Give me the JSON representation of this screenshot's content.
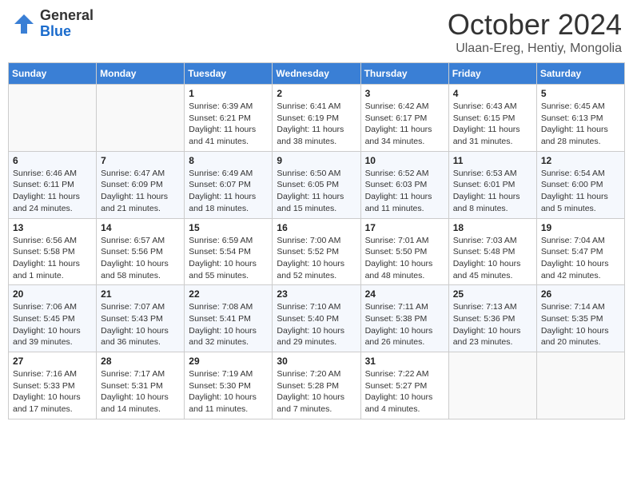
{
  "logo": {
    "general": "General",
    "blue": "Blue"
  },
  "title": {
    "month": "October 2024",
    "location": "Ulaan-Ereg, Hentiy, Mongolia"
  },
  "headers": [
    "Sunday",
    "Monday",
    "Tuesday",
    "Wednesday",
    "Thursday",
    "Friday",
    "Saturday"
  ],
  "weeks": [
    [
      {
        "day": "",
        "sunrise": "",
        "sunset": "",
        "daylight": ""
      },
      {
        "day": "",
        "sunrise": "",
        "sunset": "",
        "daylight": ""
      },
      {
        "day": "1",
        "sunrise": "Sunrise: 6:39 AM",
        "sunset": "Sunset: 6:21 PM",
        "daylight": "Daylight: 11 hours and 41 minutes."
      },
      {
        "day": "2",
        "sunrise": "Sunrise: 6:41 AM",
        "sunset": "Sunset: 6:19 PM",
        "daylight": "Daylight: 11 hours and 38 minutes."
      },
      {
        "day": "3",
        "sunrise": "Sunrise: 6:42 AM",
        "sunset": "Sunset: 6:17 PM",
        "daylight": "Daylight: 11 hours and 34 minutes."
      },
      {
        "day": "4",
        "sunrise": "Sunrise: 6:43 AM",
        "sunset": "Sunset: 6:15 PM",
        "daylight": "Daylight: 11 hours and 31 minutes."
      },
      {
        "day": "5",
        "sunrise": "Sunrise: 6:45 AM",
        "sunset": "Sunset: 6:13 PM",
        "daylight": "Daylight: 11 hours and 28 minutes."
      }
    ],
    [
      {
        "day": "6",
        "sunrise": "Sunrise: 6:46 AM",
        "sunset": "Sunset: 6:11 PM",
        "daylight": "Daylight: 11 hours and 24 minutes."
      },
      {
        "day": "7",
        "sunrise": "Sunrise: 6:47 AM",
        "sunset": "Sunset: 6:09 PM",
        "daylight": "Daylight: 11 hours and 21 minutes."
      },
      {
        "day": "8",
        "sunrise": "Sunrise: 6:49 AM",
        "sunset": "Sunset: 6:07 PM",
        "daylight": "Daylight: 11 hours and 18 minutes."
      },
      {
        "day": "9",
        "sunrise": "Sunrise: 6:50 AM",
        "sunset": "Sunset: 6:05 PM",
        "daylight": "Daylight: 11 hours and 15 minutes."
      },
      {
        "day": "10",
        "sunrise": "Sunrise: 6:52 AM",
        "sunset": "Sunset: 6:03 PM",
        "daylight": "Daylight: 11 hours and 11 minutes."
      },
      {
        "day": "11",
        "sunrise": "Sunrise: 6:53 AM",
        "sunset": "Sunset: 6:01 PM",
        "daylight": "Daylight: 11 hours and 8 minutes."
      },
      {
        "day": "12",
        "sunrise": "Sunrise: 6:54 AM",
        "sunset": "Sunset: 6:00 PM",
        "daylight": "Daylight: 11 hours and 5 minutes."
      }
    ],
    [
      {
        "day": "13",
        "sunrise": "Sunrise: 6:56 AM",
        "sunset": "Sunset: 5:58 PM",
        "daylight": "Daylight: 11 hours and 1 minute."
      },
      {
        "day": "14",
        "sunrise": "Sunrise: 6:57 AM",
        "sunset": "Sunset: 5:56 PM",
        "daylight": "Daylight: 10 hours and 58 minutes."
      },
      {
        "day": "15",
        "sunrise": "Sunrise: 6:59 AM",
        "sunset": "Sunset: 5:54 PM",
        "daylight": "Daylight: 10 hours and 55 minutes."
      },
      {
        "day": "16",
        "sunrise": "Sunrise: 7:00 AM",
        "sunset": "Sunset: 5:52 PM",
        "daylight": "Daylight: 10 hours and 52 minutes."
      },
      {
        "day": "17",
        "sunrise": "Sunrise: 7:01 AM",
        "sunset": "Sunset: 5:50 PM",
        "daylight": "Daylight: 10 hours and 48 minutes."
      },
      {
        "day": "18",
        "sunrise": "Sunrise: 7:03 AM",
        "sunset": "Sunset: 5:48 PM",
        "daylight": "Daylight: 10 hours and 45 minutes."
      },
      {
        "day": "19",
        "sunrise": "Sunrise: 7:04 AM",
        "sunset": "Sunset: 5:47 PM",
        "daylight": "Daylight: 10 hours and 42 minutes."
      }
    ],
    [
      {
        "day": "20",
        "sunrise": "Sunrise: 7:06 AM",
        "sunset": "Sunset: 5:45 PM",
        "daylight": "Daylight: 10 hours and 39 minutes."
      },
      {
        "day": "21",
        "sunrise": "Sunrise: 7:07 AM",
        "sunset": "Sunset: 5:43 PM",
        "daylight": "Daylight: 10 hours and 36 minutes."
      },
      {
        "day": "22",
        "sunrise": "Sunrise: 7:08 AM",
        "sunset": "Sunset: 5:41 PM",
        "daylight": "Daylight: 10 hours and 32 minutes."
      },
      {
        "day": "23",
        "sunrise": "Sunrise: 7:10 AM",
        "sunset": "Sunset: 5:40 PM",
        "daylight": "Daylight: 10 hours and 29 minutes."
      },
      {
        "day": "24",
        "sunrise": "Sunrise: 7:11 AM",
        "sunset": "Sunset: 5:38 PM",
        "daylight": "Daylight: 10 hours and 26 minutes."
      },
      {
        "day": "25",
        "sunrise": "Sunrise: 7:13 AM",
        "sunset": "Sunset: 5:36 PM",
        "daylight": "Daylight: 10 hours and 23 minutes."
      },
      {
        "day": "26",
        "sunrise": "Sunrise: 7:14 AM",
        "sunset": "Sunset: 5:35 PM",
        "daylight": "Daylight: 10 hours and 20 minutes."
      }
    ],
    [
      {
        "day": "27",
        "sunrise": "Sunrise: 7:16 AM",
        "sunset": "Sunset: 5:33 PM",
        "daylight": "Daylight: 10 hours and 17 minutes."
      },
      {
        "day": "28",
        "sunrise": "Sunrise: 7:17 AM",
        "sunset": "Sunset: 5:31 PM",
        "daylight": "Daylight: 10 hours and 14 minutes."
      },
      {
        "day": "29",
        "sunrise": "Sunrise: 7:19 AM",
        "sunset": "Sunset: 5:30 PM",
        "daylight": "Daylight: 10 hours and 11 minutes."
      },
      {
        "day": "30",
        "sunrise": "Sunrise: 7:20 AM",
        "sunset": "Sunset: 5:28 PM",
        "daylight": "Daylight: 10 hours and 7 minutes."
      },
      {
        "day": "31",
        "sunrise": "Sunrise: 7:22 AM",
        "sunset": "Sunset: 5:27 PM",
        "daylight": "Daylight: 10 hours and 4 minutes."
      },
      {
        "day": "",
        "sunrise": "",
        "sunset": "",
        "daylight": ""
      },
      {
        "day": "",
        "sunrise": "",
        "sunset": "",
        "daylight": ""
      }
    ]
  ]
}
